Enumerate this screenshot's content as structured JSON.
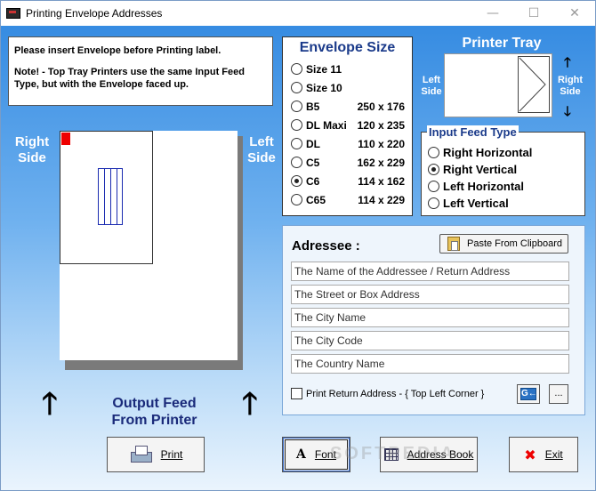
{
  "window": {
    "title": "Printing Envelope Addresses",
    "minimize_glyph": "—",
    "maximize_glyph": "☐",
    "close_glyph": "✕"
  },
  "notice": {
    "line1": "Please insert Envelope before Printing label.",
    "line2": "Note!  -  Top Tray Printers use the same Input Feed Type, but  with the Envelope faced up."
  },
  "envelope_size": {
    "header": "Envelope Size",
    "options": [
      {
        "label": "Size 11",
        "dims": "",
        "selected": false
      },
      {
        "label": "Size 10",
        "dims": "",
        "selected": false
      },
      {
        "label": "B5",
        "dims": "250 x 176",
        "selected": false
      },
      {
        "label": "DL Maxi",
        "dims": "120 x 235",
        "selected": false
      },
      {
        "label": "DL",
        "dims": "110 x 220",
        "selected": false
      },
      {
        "label": "C5",
        "dims": "162 x 229",
        "selected": false
      },
      {
        "label": "C6",
        "dims": "114 x 162",
        "selected": true
      },
      {
        "label": "C65",
        "dims": "114 x 229",
        "selected": false
      }
    ]
  },
  "printer_tray": {
    "title": "Printer Tray",
    "left_label": "Left Side",
    "right_label": "Right Side",
    "up_arrow": "🡑",
    "down_arrow": "🡓"
  },
  "input_feed": {
    "legend": "Input Feed Type",
    "options": [
      {
        "label": "Right Horizontal",
        "selected": false
      },
      {
        "label": "Right Vertical",
        "selected": true
      },
      {
        "label": "Left Horizontal",
        "selected": false
      },
      {
        "label": "Left Vertical",
        "selected": false
      }
    ]
  },
  "preview": {
    "right_side": "Right Side",
    "left_side": "Left Side",
    "output_feed": "Output Feed From Printer",
    "arrow": "🡑"
  },
  "addressee": {
    "title": "Adressee :",
    "paste_button": "Paste From Clipboard",
    "fields": [
      "The Name of the Addressee / Return Address",
      "The Street or Box Address",
      "The City Name",
      "The City Code",
      "The Country Name"
    ],
    "print_return_label": "Print Return Address - { Top Left Corner }",
    "print_return_checked": false,
    "return_icon_text": "G←",
    "dots_button": "..."
  },
  "buttons": {
    "print": "Print",
    "font": "Font",
    "font_icon": "A",
    "address_book": "Address Book",
    "exit": "Exit",
    "exit_icon": "✖"
  },
  "watermark": "SOFTPEDIA"
}
